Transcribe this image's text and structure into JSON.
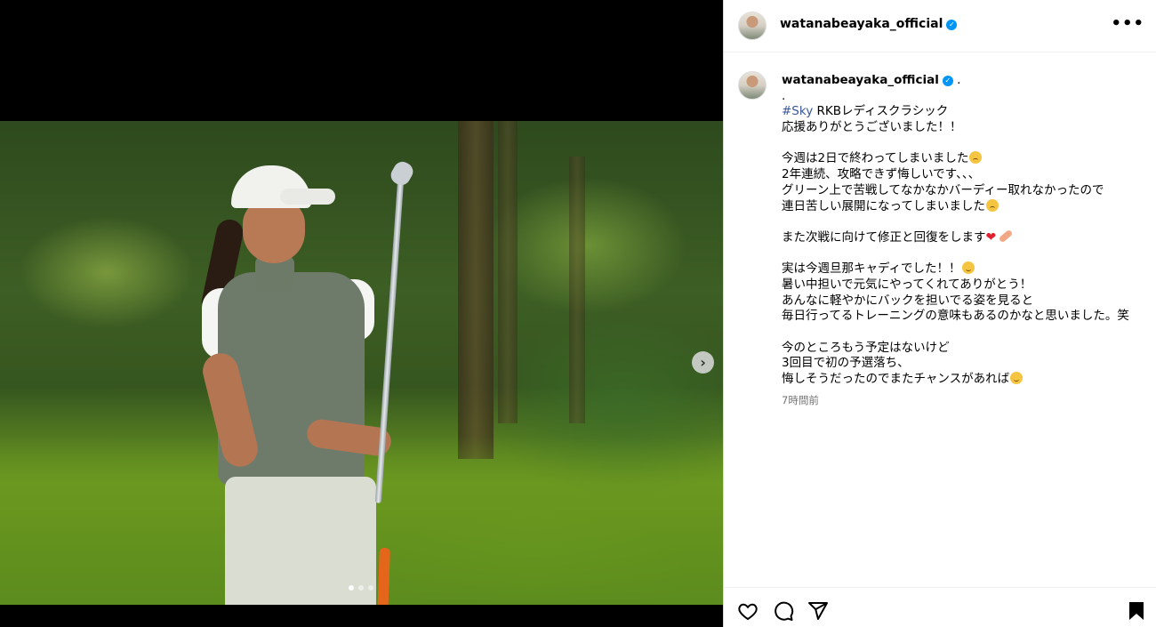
{
  "post": {
    "username": "watanabeayaka_official",
    "more_label": "•••",
    "caption": {
      "username": "watanabeayaka_official",
      "after_user": " .",
      "dot": ".",
      "hashtag": "#Sky",
      "line1_rest": " RKBレディスクラシック",
      "line2": "応援ありがとうございました！！",
      "line3": "今週は2日で終わってしまいました",
      "line4": "2年連続、攻略できず悔しいです、、、",
      "line5": "グリーン上で苦戦してなかなかバーディー取れなかったので",
      "line6": "連日苦しい展開になってしまいました",
      "line7": "また次戦に向けて修正と回復をします",
      "line8": "実は今週旦那キャディでした！！",
      "line9": "暑い中担いで元気にやってくれてありがとう！",
      "line10": "あんなに軽やかにバックを担いでる姿を見ると",
      "line11": "毎日行ってるトレーニングの意味もあるのかなと思いました。笑",
      "line12": "今のところもう予定はないけど",
      "line13": "3回目で初の予選落ち、",
      "line14": "悔しそうだったのでまたチャンスがあれば"
    },
    "timestamp": "7時間前"
  },
  "media": {
    "next_label": "›",
    "carousel_count": 3,
    "carousel_active": 1
  },
  "icons": {
    "like": "heart-icon",
    "comment": "comment-icon",
    "share": "share-icon",
    "save": "bookmark-icon",
    "verified": "verified-badge-icon",
    "next": "chevron-right-icon"
  }
}
